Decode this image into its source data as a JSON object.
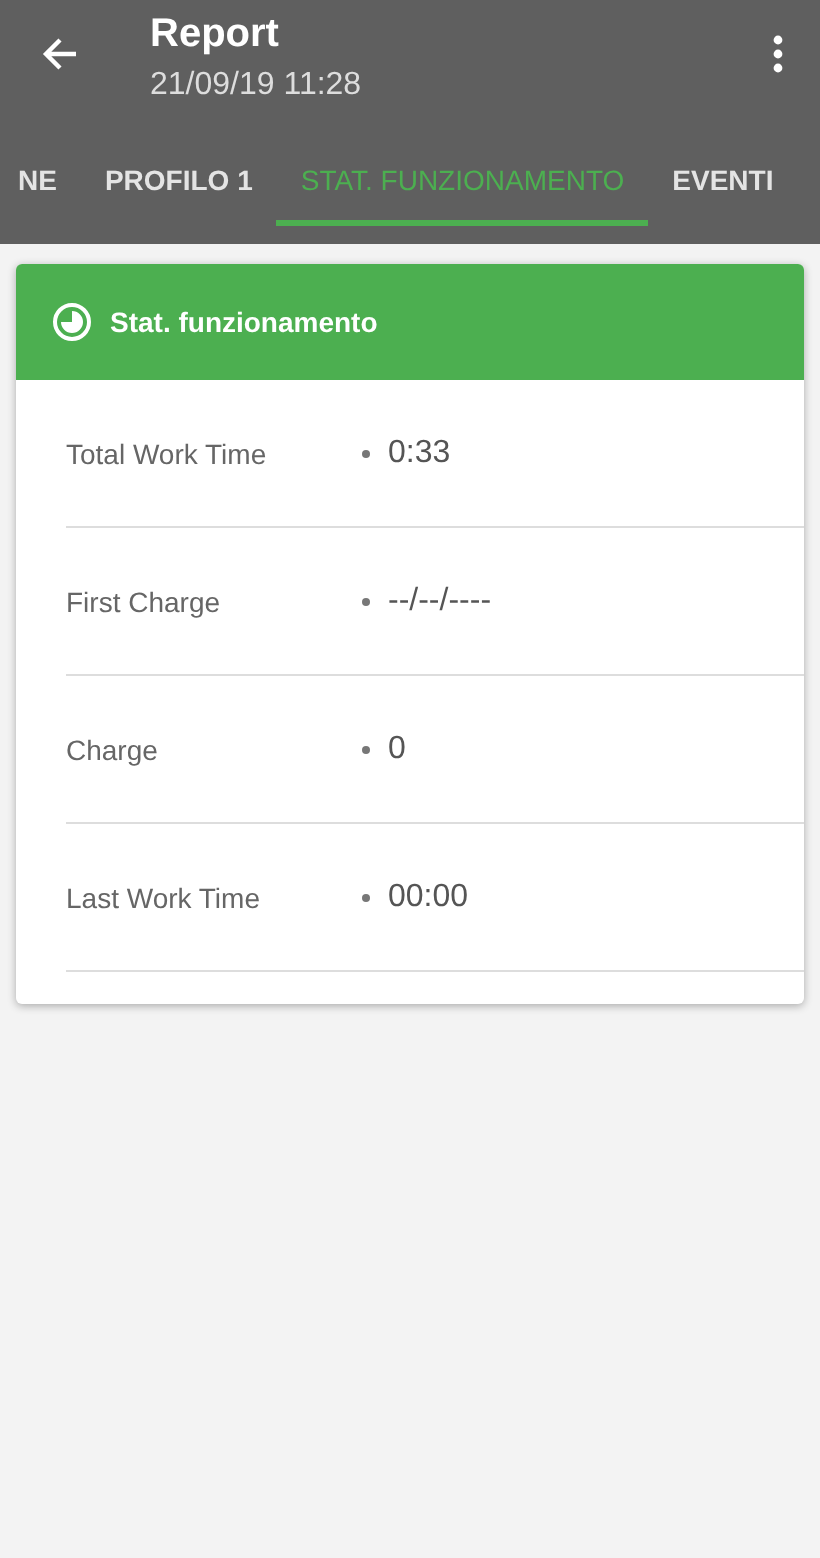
{
  "app_bar": {
    "title": "Report",
    "subtitle": "21/09/19 11:28"
  },
  "tabs": [
    {
      "label": "NE",
      "selected": false
    },
    {
      "label": "PROFILO 1",
      "selected": false
    },
    {
      "label": "STAT. FUNZIONAMENTO",
      "selected": true
    },
    {
      "label": "EVENTI",
      "selected": false
    }
  ],
  "card": {
    "title": "Stat. funzionamento",
    "rows": [
      {
        "label": "Total Work Time",
        "value": "0:33"
      },
      {
        "label": "First Charge",
        "value": "--/--/----"
      },
      {
        "label": "Charge",
        "value": "0"
      },
      {
        "label": "Last Work Time",
        "value": "00:00"
      }
    ]
  }
}
